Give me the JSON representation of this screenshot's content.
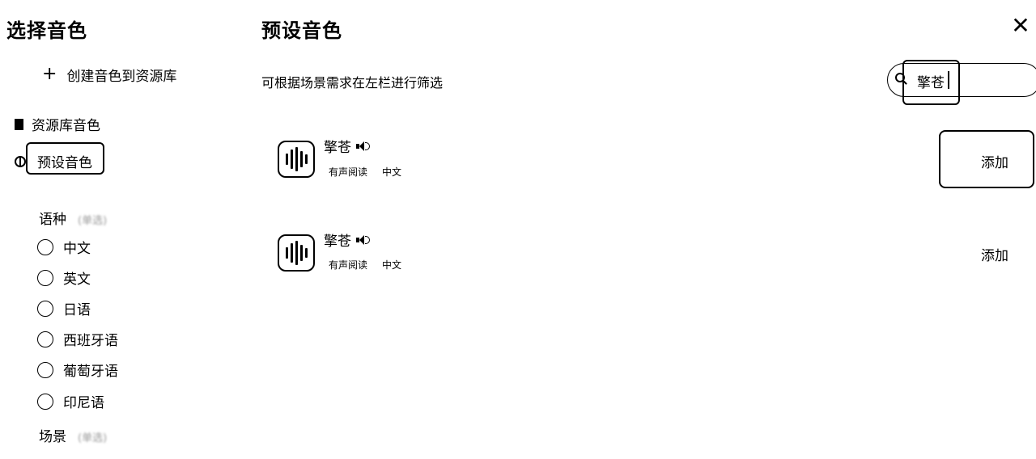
{
  "left": {
    "title": "选择音色",
    "create_button": "创建音色到资源库",
    "nav": {
      "library": "资源库音色",
      "preset": "预设音色"
    },
    "filters": {
      "language_label": "语种",
      "language_hint": "(单选)",
      "languages": [
        "中文",
        "英文",
        "日语",
        "西班牙语",
        "葡萄牙语",
        "印尼语"
      ],
      "scene_label": "场景",
      "scene_hint": "(单选)"
    }
  },
  "main": {
    "title": "预设音色",
    "subtitle": "可根据场景需求在左栏进行筛选",
    "search": {
      "value": "擎苍"
    },
    "voices": [
      {
        "name": "擎苍",
        "tags": [
          "有声阅读",
          "中文"
        ],
        "add_label": "添加"
      },
      {
        "name": "擎苍",
        "tags": [
          "有声阅读",
          "中文"
        ],
        "add_label": "添加"
      }
    ],
    "close_icon": "close-icon",
    "close_glyph": "✕"
  }
}
